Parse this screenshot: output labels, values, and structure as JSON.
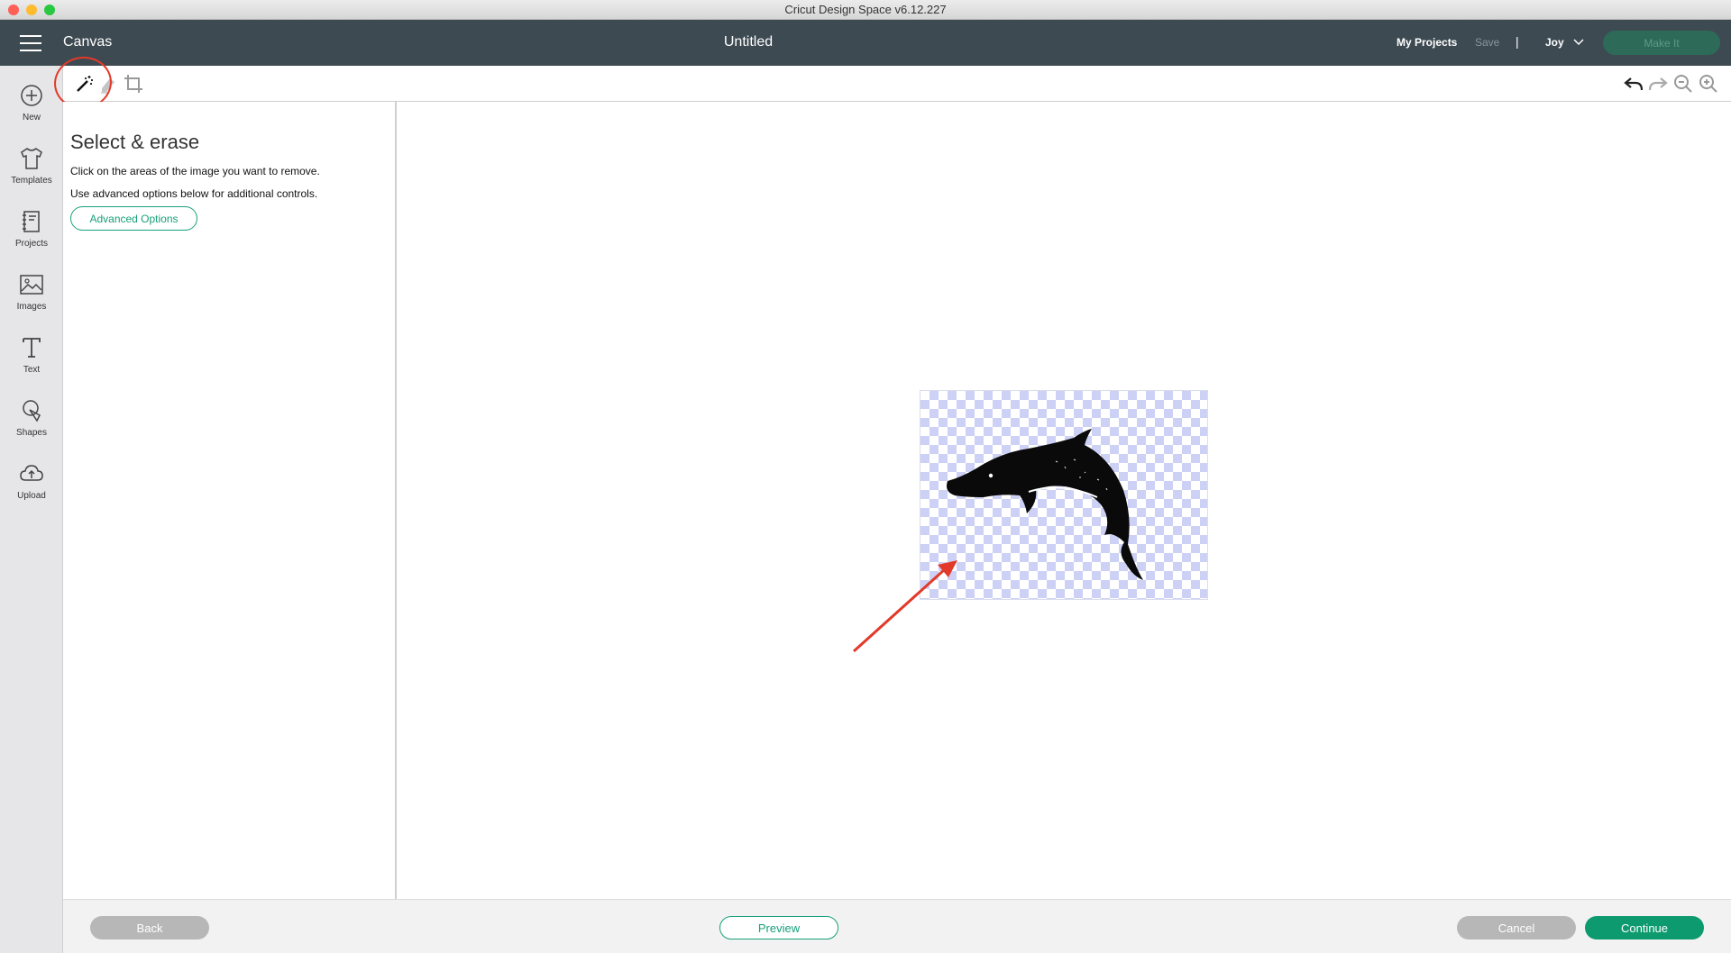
{
  "window": {
    "title": "Cricut Design Space  v6.12.227",
    "traffic_lights": {
      "close": "#fe5f57",
      "minimize": "#febb2e",
      "zoom": "#28c840"
    }
  },
  "header": {
    "section": "Canvas",
    "doc_title": "Untitled",
    "my_projects": "My Projects",
    "save": "Save",
    "separator": "|",
    "user": "Joy",
    "make_it": "Make It"
  },
  "leftnav": {
    "items": [
      {
        "label": "New",
        "icon": "plus-circle-icon"
      },
      {
        "label": "Templates",
        "icon": "tshirt-icon"
      },
      {
        "label": "Projects",
        "icon": "notebook-icon"
      },
      {
        "label": "Images",
        "icon": "picture-icon"
      },
      {
        "label": "Text",
        "icon": "text-t-icon"
      },
      {
        "label": "Shapes",
        "icon": "shapes-icon"
      },
      {
        "label": "Upload",
        "icon": "cloud-upload-icon"
      }
    ]
  },
  "toolbar": {
    "tools": [
      "magic-wand-icon",
      "eraser-icon",
      "crop-icon"
    ],
    "right_tools": [
      "undo-icon",
      "redo-icon",
      "zoom-out-icon",
      "zoom-in-icon"
    ]
  },
  "panel": {
    "title": "Select & erase",
    "instruction_1": "Click on the areas of the image you want to remove.",
    "instruction_2": "Use advanced options below for additional controls.",
    "advanced_options": "Advanced Options"
  },
  "footer": {
    "back": "Back",
    "preview": "Preview",
    "cancel": "Cancel",
    "continue": "Continue"
  },
  "colors": {
    "header_bg": "#3d4a52",
    "accent": "#17a07a",
    "continue": "#0d9a6e",
    "annotation": "#e23a2a",
    "checker": "#cdd1f5"
  }
}
